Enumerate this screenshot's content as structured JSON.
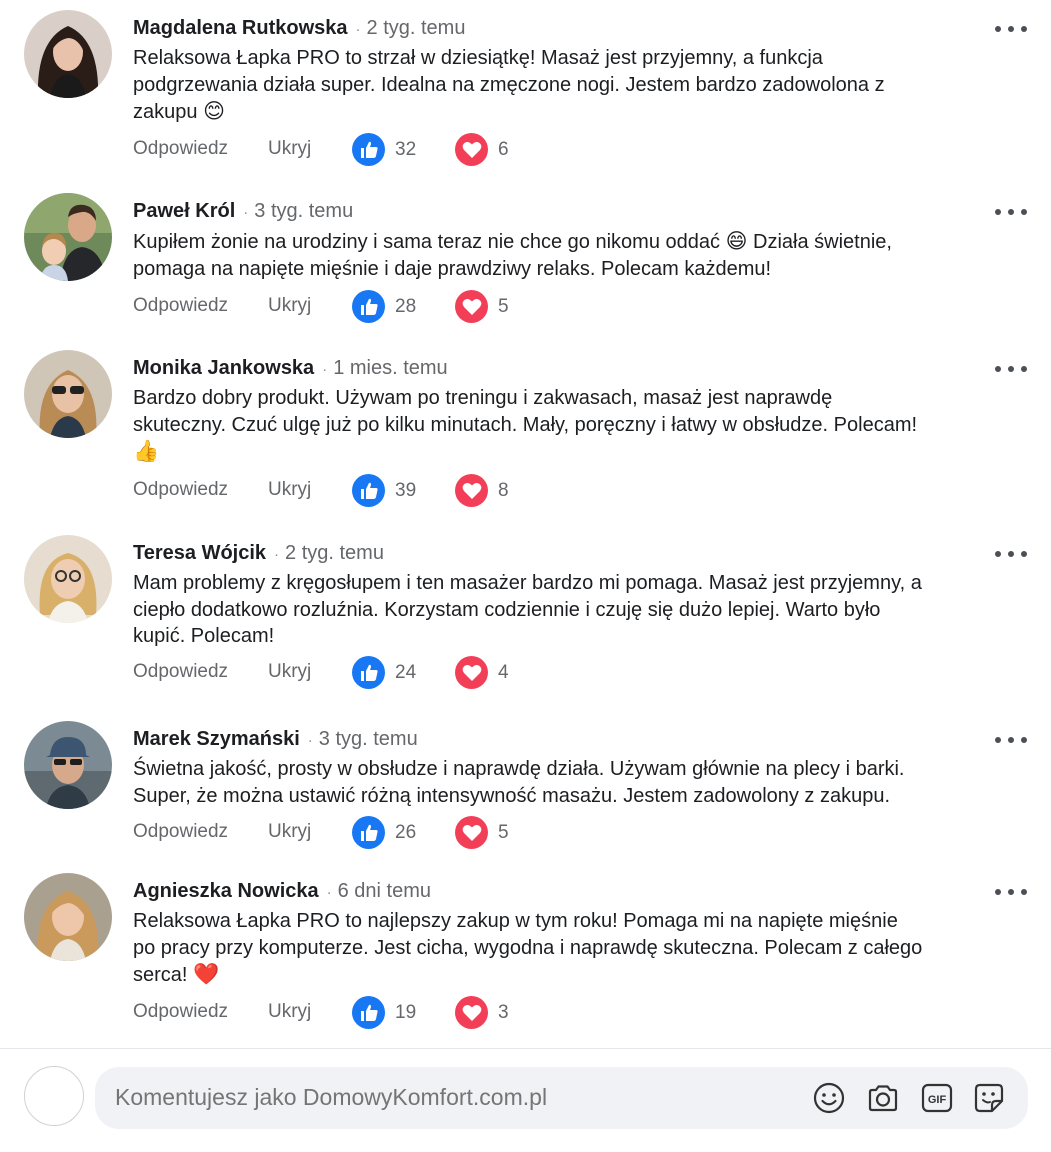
{
  "comments": [
    {
      "author": "Magdalena Rutkowska",
      "time": "2 tyg. temu",
      "text": "Relaksowa Łapka PRO to strzał w dziesiątkę! Masaż jest przyjemny, a funkcja podgrzewania działa super. Idealna na zmęczone nogi. Jestem bardzo zadowolona z zakupu",
      "emoji": "😊",
      "reply_label": "Odpowiedz",
      "hide_label": "Ukryj",
      "likes": "32",
      "loves": "6"
    },
    {
      "author": "Paweł Król",
      "time": "3 tyg. temu",
      "text": "Kupiłem żonie na urodziny i sama teraz nie chce go nikomu oddać",
      "emoji": "😄",
      "text2": "Działa świetnie, pomaga na napięte mięśnie i daje prawdziwy relaks. Polecam każdemu!",
      "reply_label": "Odpowiedz",
      "hide_label": "Ukryj",
      "likes": "28",
      "loves": "5"
    },
    {
      "author": "Monika Jankowska",
      "time": "1 mies. temu",
      "text": "Bardzo dobry produkt. Używam po treningu i zakwasach, masaż jest naprawdę skuteczny. Czuć ulgę już po kilku minutach. Mały, poręczny i łatwy w obsłudze. Polecam!",
      "emoji": "👍",
      "reply_label": "Odpowiedz",
      "hide_label": "Ukryj",
      "likes": "39",
      "loves": "8"
    },
    {
      "author": "Teresa Wójcik",
      "time": "2 tyg. temu",
      "text": "Mam problemy z kręgosłupem i ten masażer bardzo mi pomaga. Masaż jest przyjemny, a ciepło dodatkowo rozluźnia. Korzystam codziennie i czuję się dużo lepiej. Warto było kupić. Polecam!",
      "reply_label": "Odpowiedz",
      "hide_label": "Ukryj",
      "likes": "24",
      "loves": "4"
    },
    {
      "author": "Marek Szymański",
      "time": "3 tyg. temu",
      "text": "Świetna jakość, prosty w obsłudze i naprawdę działa. Używam głównie na plecy i barki. Super, że można ustawić różną intensywność masażu. Jestem zadowolony z zakupu.",
      "reply_label": "Odpowiedz",
      "hide_label": "Ukryj",
      "likes": "26",
      "loves": "5"
    },
    {
      "author": "Agnieszka Nowicka",
      "time": "6 dni temu",
      "text": "Relaksowa Łapka PRO to najlepszy zakup w tym roku! Pomaga mi na napięte mięśnie po pracy przy komputerze. Jest cicha, wygodna i naprawdę skuteczna. Polecam z całego serca!",
      "emoji": "❤️",
      "reply_label": "Odpowiedz",
      "hide_label": "Ukryj",
      "likes": "19",
      "loves": "3"
    }
  ],
  "composer": {
    "placeholder": "Komentujesz jako DomowyKomfort.com.pl",
    "icons": [
      "smiley-icon",
      "camera-icon",
      "gif-icon",
      "sticker-icon"
    ]
  },
  "colors": {
    "like": "#1877f2",
    "love": "#f33e58",
    "meta": "#65676b"
  }
}
